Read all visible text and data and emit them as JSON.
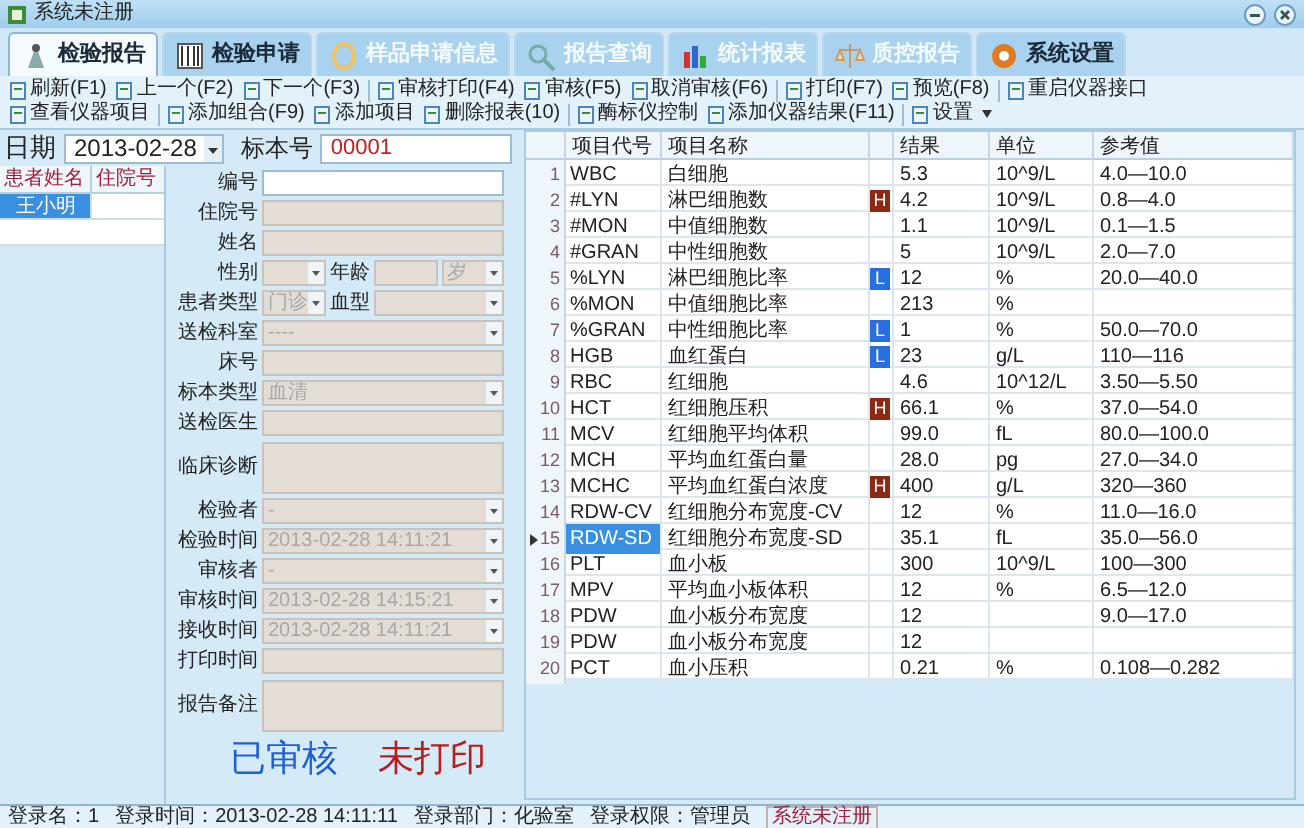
{
  "window": {
    "title": "系统未注册"
  },
  "tabs": [
    {
      "label": "检验报告",
      "selected": true,
      "disabled": false
    },
    {
      "label": "检验申请",
      "selected": false,
      "disabled": false
    },
    {
      "label": "样品申请信息",
      "selected": false,
      "disabled": true
    },
    {
      "label": "报告查询",
      "selected": false,
      "disabled": true
    },
    {
      "label": "统计报表",
      "selected": false,
      "disabled": true
    },
    {
      "label": "质控报告",
      "selected": false,
      "disabled": true
    },
    {
      "label": "系统设置",
      "selected": false,
      "disabled": false
    }
  ],
  "toolbar_groups": [
    [
      "刷新(F1)",
      "上一个(F2)",
      "下一个(F3)"
    ],
    [
      "审核打印(F4)",
      "审核(F5)",
      "取消审核(F6)"
    ],
    [
      "打印(F7)",
      "预览(F8)"
    ],
    [
      "重启仪器接口",
      "查看仪器项目"
    ],
    [
      "添加组合(F9)",
      "添加项目",
      "删除报表(10)"
    ],
    [
      "酶标仪控制",
      "添加仪器结果(F11)"
    ],
    [
      "设置"
    ]
  ],
  "header": {
    "date_label": "日期",
    "date": "2013-02-28",
    "sample_label": "标本号",
    "sample_no": "00001"
  },
  "patients": {
    "columns": [
      "患者姓名",
      "住院号"
    ],
    "rows": [
      {
        "name": "王小明",
        "selected": true
      }
    ]
  },
  "form": [
    {
      "fields": [
        {
          "label": "编号",
          "kind": "text",
          "disabled": false
        }
      ]
    },
    {
      "fields": [
        {
          "label": "住院号",
          "kind": "text",
          "disabled": true
        }
      ]
    },
    {
      "fields": [
        {
          "label": "姓名",
          "kind": "text",
          "disabled": true
        }
      ]
    },
    {
      "fields": [
        {
          "label": "性别",
          "kind": "select",
          "disabled": true
        },
        {
          "label": "年龄",
          "kind": "text",
          "disabled": true
        },
        {
          "kind": "select",
          "value": "岁",
          "disabled": true
        }
      ]
    },
    {
      "fields": [
        {
          "label": "患者类型",
          "kind": "select",
          "value": "门诊",
          "disabled": true
        },
        {
          "label": "血型",
          "kind": "select",
          "disabled": true
        }
      ]
    },
    {
      "fields": [
        {
          "label": "送检科室",
          "kind": "select",
          "value": "----",
          "disabled": true
        }
      ]
    },
    {
      "fields": [
        {
          "label": "床号",
          "kind": "text",
          "disabled": true
        }
      ]
    },
    {
      "fields": [
        {
          "label": "标本类型",
          "kind": "select",
          "value": "血清",
          "disabled": true
        }
      ]
    },
    {
      "fields": [
        {
          "label": "送检医生",
          "kind": "text",
          "disabled": true
        }
      ]
    },
    {
      "fields": [
        {
          "label": "临床诊断",
          "kind": "area",
          "disabled": true
        }
      ]
    },
    {
      "fields": [
        {
          "label": "检验者",
          "kind": "select",
          "value": "-",
          "disabled": true
        }
      ]
    },
    {
      "fields": [
        {
          "label": "检验时间",
          "kind": "select",
          "value": "2013-02-28 14:11:21",
          "disabled": true
        }
      ]
    },
    {
      "fields": [
        {
          "label": "审核者",
          "kind": "select",
          "value": "-",
          "disabled": true
        }
      ]
    },
    {
      "fields": [
        {
          "label": "审核时间",
          "kind": "select",
          "value": "2013-02-28 14:15:21",
          "disabled": true
        }
      ]
    },
    {
      "fields": [
        {
          "label": "接收时间",
          "kind": "select",
          "value": "2013-02-28 14:11:21",
          "disabled": true
        }
      ]
    },
    {
      "fields": [
        {
          "label": "打印时间",
          "kind": "text",
          "disabled": true
        }
      ]
    },
    {
      "fields": [
        {
          "label": "报告备注",
          "kind": "area",
          "disabled": true
        }
      ]
    }
  ],
  "status_marks": [
    {
      "text": "已审核",
      "color": "#1f5fd6"
    },
    {
      "text": "未打印",
      "color": "#b81c1c"
    }
  ],
  "results": {
    "columns": [
      "项目代号",
      "项目名称",
      "结果",
      "单位",
      "参考值"
    ],
    "rows": [
      {
        "no": "1",
        "code": "WBC",
        "name": "白细胞",
        "result": "5.3",
        "unit": "10^9/L",
        "ref": "4.0—10.0",
        "selected": false
      },
      {
        "no": "2",
        "code": "#LYN",
        "name": "淋巴细胞数",
        "flag": {
          "text": "H",
          "color": "#8b2a14"
        },
        "result": "4.2",
        "unit": "10^9/L",
        "ref": "0.8—4.0",
        "selected": false
      },
      {
        "no": "3",
        "code": "#MON",
        "name": "中值细胞数",
        "result": "1.1",
        "unit": "10^9/L",
        "ref": "0.1—1.5",
        "selected": false
      },
      {
        "no": "4",
        "code": "#GRAN",
        "name": "中性细胞数",
        "result": "5",
        "unit": "10^9/L",
        "ref": "2.0—7.0",
        "selected": false
      },
      {
        "no": "5",
        "code": "%LYN",
        "name": "淋巴细胞比率",
        "flag": {
          "text": "L",
          "color": "#2a6fe0"
        },
        "result": "12",
        "unit": "%",
        "ref": "20.0—40.0",
        "selected": false
      },
      {
        "no": "6",
        "code": "%MON",
        "name": "中值细胞比率",
        "result": "213",
        "unit": "%",
        "selected": false
      },
      {
        "no": "7",
        "code": "%GRAN",
        "name": "中性细胞比率",
        "flag": {
          "text": "L",
          "color": "#2a6fe0"
        },
        "result": "1",
        "unit": "%",
        "ref": "50.0—70.0",
        "selected": false
      },
      {
        "no": "8",
        "code": "HGB",
        "name": "血红蛋白",
        "flag": {
          "text": "L",
          "color": "#2a6fe0"
        },
        "result": "23",
        "unit": "g/L",
        "ref": "110—116",
        "selected": false
      },
      {
        "no": "9",
        "code": "RBC",
        "name": "红细胞",
        "result": "4.6",
        "unit": "10^12/L",
        "ref": "3.50—5.50",
        "selected": false
      },
      {
        "no": "10",
        "code": "HCT",
        "name": "红细胞压积",
        "flag": {
          "text": "H",
          "color": "#8b2a14"
        },
        "result": "66.1",
        "unit": "%",
        "ref": "37.0—54.0",
        "selected": false
      },
      {
        "no": "11",
        "code": "MCV",
        "name": "红细胞平均体积",
        "result": "99.0",
        "unit": "fL",
        "ref": "80.0—100.0",
        "selected": false
      },
      {
        "no": "12",
        "code": "MCH",
        "name": "平均血红蛋白量",
        "result": "28.0",
        "unit": "pg",
        "ref": "27.0—34.0",
        "selected": false
      },
      {
        "no": "13",
        "code": "MCHC",
        "name": "平均血红蛋白浓度",
        "flag": {
          "text": "H",
          "color": "#8b2a14"
        },
        "result": "400",
        "unit": "g/L",
        "ref": "320—360",
        "selected": false
      },
      {
        "no": "14",
        "code": "RDW-CV",
        "name": "红细胞分布宽度-CV",
        "result": "12",
        "unit": "%",
        "ref": "11.0—16.0",
        "selected": false
      },
      {
        "no": "15",
        "code": "RDW-SD",
        "name": "红细胞分布宽度-SD",
        "result": "35.1",
        "unit": "fL",
        "ref": "35.0—56.0",
        "selected": true
      },
      {
        "no": "16",
        "code": "PLT",
        "name": "血小板",
        "result": "300",
        "unit": "10^9/L",
        "ref": "100—300",
        "selected": false
      },
      {
        "no": "17",
        "code": "MPV",
        "name": "平均血小板体积",
        "result": "12",
        "unit": "%",
        "ref": "6.5—12.0",
        "selected": false
      },
      {
        "no": "18",
        "code": "PDW",
        "name": "血小板分布宽度",
        "result": "12",
        "ref": "9.0—17.0",
        "selected": false
      },
      {
        "no": "19",
        "code": "PDW",
        "name": "血小板分布宽度",
        "result": "12",
        "selected": false
      },
      {
        "no": "20",
        "code": "PCT",
        "name": "血小压积",
        "result": "0.21",
        "unit": "%",
        "ref": "0.108—0.282",
        "selected": false
      }
    ]
  },
  "status_bar": [
    "登录名：1",
    "登录时间：2013-02-28 14:11:11",
    "登录部门：化验室",
    "登录权限：管理员",
    "系统未注册"
  ]
}
